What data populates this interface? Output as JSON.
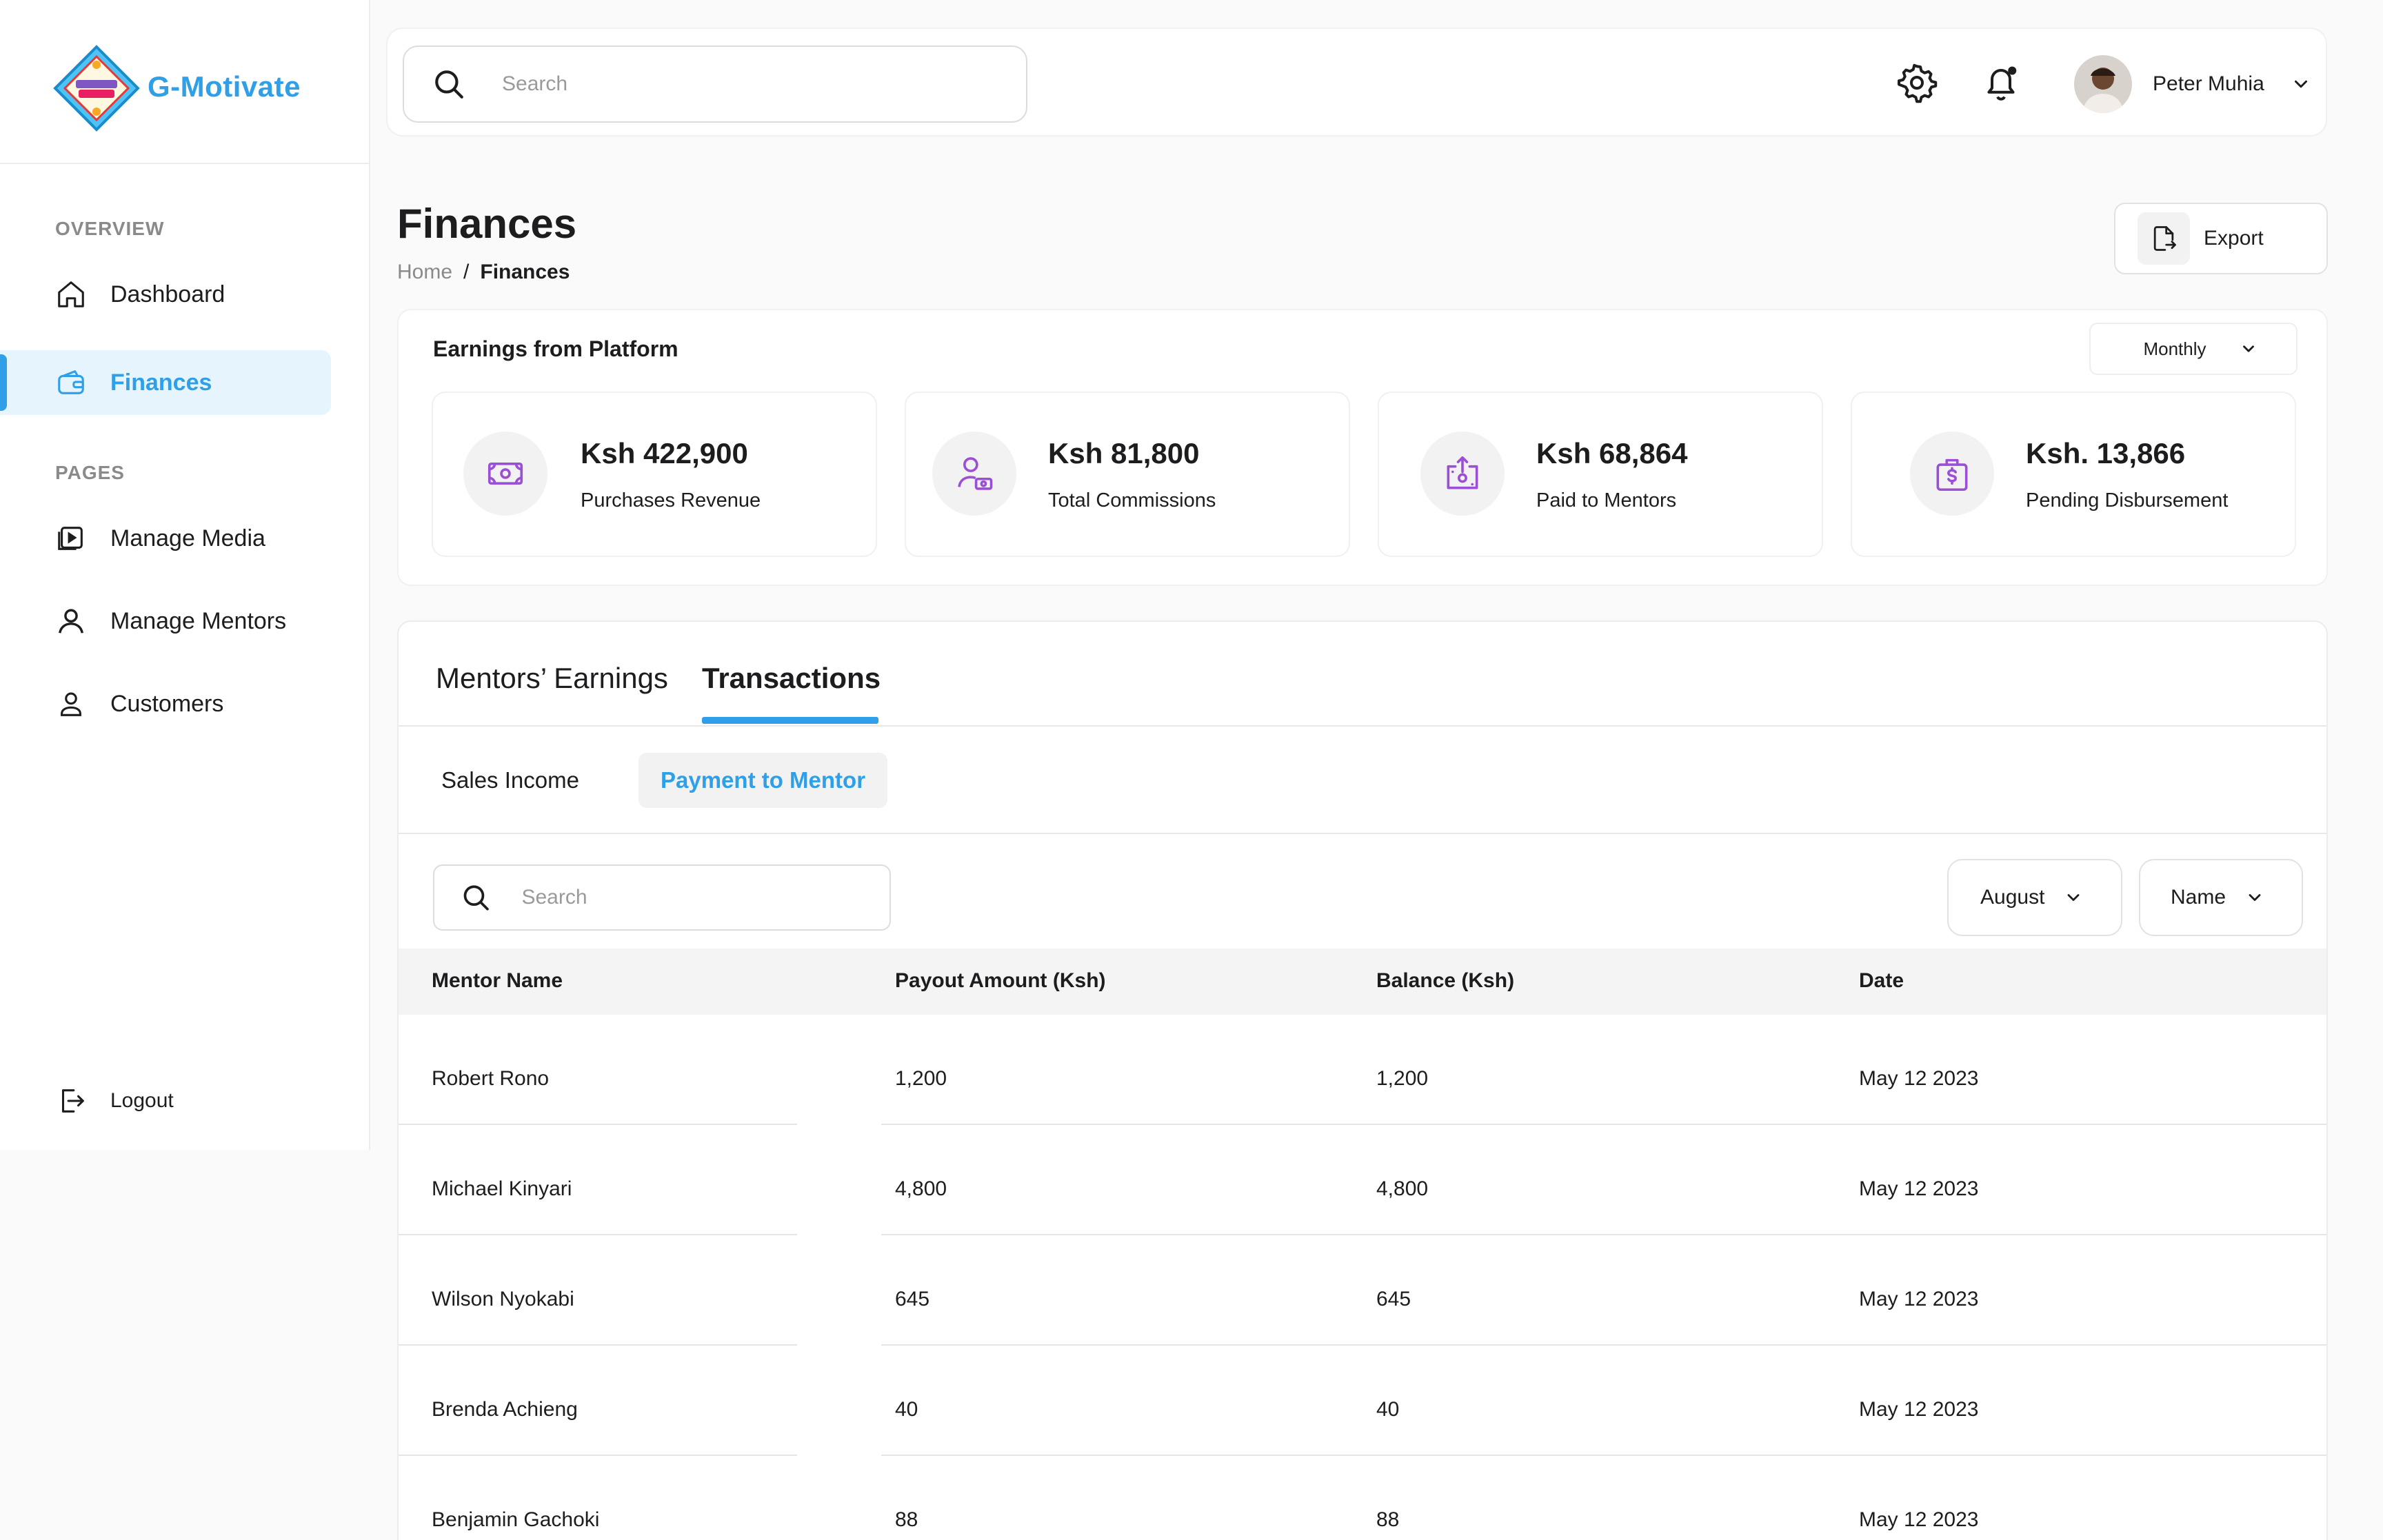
{
  "brand": {
    "name": "G-Motivate",
    "logo_text": "G-MOTIVATE"
  },
  "sidebar": {
    "overview_label": "OVERVIEW",
    "pages_label": "PAGES",
    "items": [
      {
        "label": "Dashboard",
        "icon": "home-icon"
      },
      {
        "label": "Finances",
        "icon": "wallet-icon",
        "active": true
      },
      {
        "label": "Manage Media",
        "icon": "media-icon"
      },
      {
        "label": "Manage Mentors",
        "icon": "mentor-icon"
      },
      {
        "label": "Customers",
        "icon": "user-icon"
      }
    ],
    "logout_label": "Logout"
  },
  "topbar": {
    "search_placeholder": "Search",
    "user_name": "Peter Muhia"
  },
  "header": {
    "title": "Finances",
    "breadcrumb": {
      "home": "Home",
      "separator": "/",
      "current": "Finances"
    },
    "export_label": "Export"
  },
  "earnings": {
    "title": "Earnings from Platform",
    "period": "Monthly",
    "stats": [
      {
        "value": "Ksh 422,900",
        "caption": "Purchases Revenue",
        "icon": "money-icon"
      },
      {
        "value": "Ksh 81,800",
        "caption": "Total Commissions",
        "icon": "user-cash-icon"
      },
      {
        "value": "Ksh 68,864",
        "caption": "Paid to Mentors",
        "icon": "payout-icon"
      },
      {
        "value": "Ksh. 13,866",
        "caption": "Pending Disbursement",
        "icon": "briefcase-dollar-icon"
      }
    ]
  },
  "panel": {
    "tabs": [
      "Mentors’ Earnings",
      "Transactions"
    ],
    "active_tab": "Transactions",
    "subtabs": [
      "Sales Income",
      "Payment to Mentor"
    ],
    "active_subtab": "Payment to Mentor",
    "search_placeholder": "Search",
    "filters": {
      "month": "August",
      "sort": "Name"
    },
    "columns": [
      "Mentor Name",
      "Payout Amount (Ksh)",
      "Balance (Ksh)",
      "Date"
    ],
    "rows": [
      [
        "Robert Rono",
        "1,200",
        "1,200",
        "May 12 2023"
      ],
      [
        "Michael Kinyari",
        "4,800",
        "4,800",
        "May 12 2023"
      ],
      [
        "Wilson Nyokabi",
        "645",
        "645",
        "May 12 2023"
      ],
      [
        "Brenda Achieng",
        "40",
        "40",
        "May 12 2023"
      ],
      [
        "Benjamin Gachoki",
        "88",
        "88",
        "May 12 2023"
      ]
    ]
  },
  "colors": {
    "accent": "#2f9fe8",
    "icon_purple": "#9b4fd6",
    "active_bg": "#e6f4fd"
  }
}
